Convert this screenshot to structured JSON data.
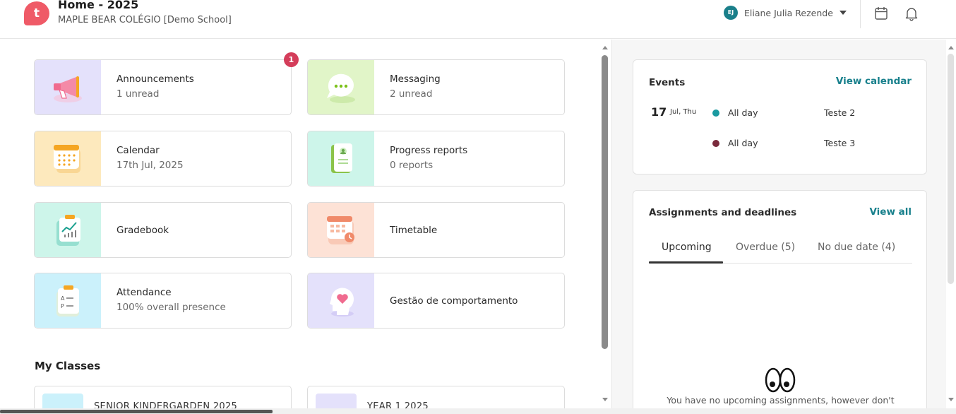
{
  "header": {
    "logo_letter": "t",
    "title": "Home - 2025",
    "school": "MAPLE BEAR COLÉGIO [Demo School]",
    "user_initials": "EJ",
    "user_name": "Eliane Julia Rezende",
    "icons": [
      "calendar-icon",
      "bell-icon"
    ]
  },
  "tiles": {
    "announcements": {
      "title": "Announcements",
      "subtitle": "1 unread",
      "badge": "1",
      "bg": "#e4e1fb",
      "icon": "megaphone-icon"
    },
    "messaging": {
      "title": "Messaging",
      "subtitle": "2 unread",
      "bg": "#e1f5c8",
      "icon": "chat-bubble-icon"
    },
    "calendar": {
      "title": "Calendar",
      "subtitle": "17th Jul, 2025",
      "bg": "#fde9bd",
      "icon": "calendar-icon"
    },
    "progress_reports": {
      "title": "Progress reports",
      "subtitle": "0 reports",
      "bg": "#cdf5ea",
      "icon": "report-book-icon"
    },
    "gradebook": {
      "title": "Gradebook",
      "bg": "#cdf5ea",
      "icon": "chart-clipboard-icon"
    },
    "timetable": {
      "title": "Timetable",
      "bg": "#fde2d6",
      "icon": "timetable-icon"
    },
    "attendance": {
      "title": "Attendance",
      "subtitle": "100% overall presence",
      "bg": "#cbf1fb",
      "icon": "attendance-clipboard-icon"
    },
    "behaviour": {
      "title": "Gestão de comportamento",
      "bg": "#e4e1fb",
      "icon": "head-heart-icon"
    }
  },
  "my_classes": {
    "title": "My Classes",
    "items": [
      {
        "name": "SENIOR KINDERGARDEN 2025",
        "color": "#cbf1fb"
      },
      {
        "name": "YEAR 1 2025",
        "color": "#e4e1fb"
      }
    ]
  },
  "events": {
    "title": "Events",
    "link": "View calendar",
    "day": "17",
    "month_weekday": "Jul, Thu",
    "items": [
      {
        "when": "All day",
        "name": "Teste 2",
        "color": "#1a9aa0"
      },
      {
        "when": "All day",
        "name": "Teste 3",
        "color": "#7a2a3c"
      }
    ]
  },
  "assignments": {
    "title": "Assignments and deadlines",
    "link": "View all",
    "tabs": [
      "Upcoming",
      "Overdue (5)",
      "No due date (4)"
    ],
    "active_tab": "Upcoming",
    "empty_message": "You have no upcoming assignments, however don't"
  },
  "colors": {
    "accent": "#18808c",
    "brand": "#ef5a67",
    "badge": "#d43d5a"
  }
}
